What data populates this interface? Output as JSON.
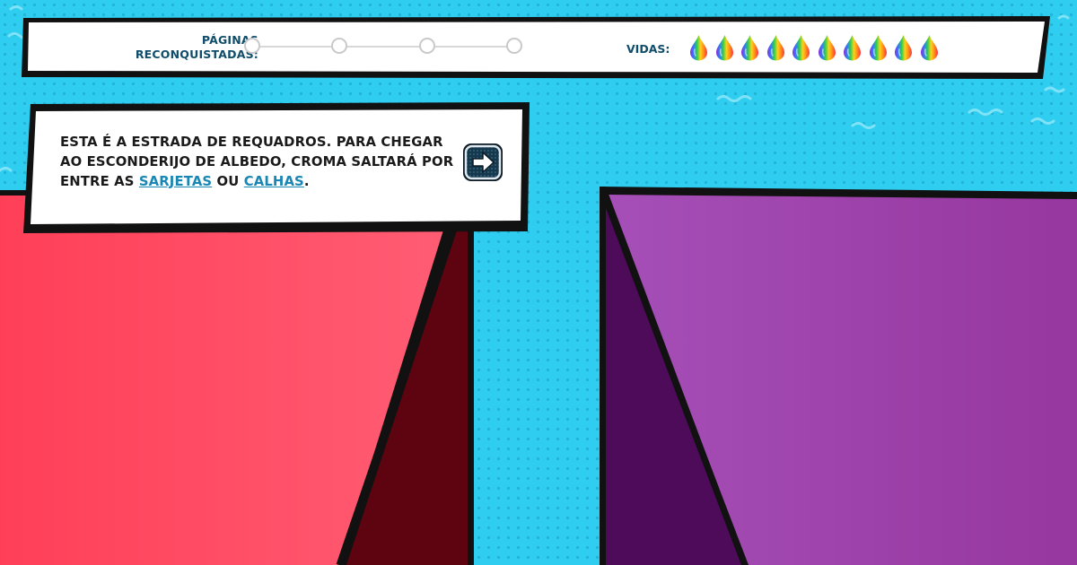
{
  "status_bar": {
    "pages_label_line1": "PÁGINAS",
    "pages_label_line2": "RECONQUISTADAS:",
    "pages_total": 4,
    "pages_reclaimed": 0,
    "lives_label": "VIDAS:",
    "lives_count": 10,
    "life_icon": "rainbow-drop-icon"
  },
  "dialog": {
    "text_line1": "ESTA É A ESTRADA DE REQUADROS. PARA CHEGAR",
    "text_line2": "AO ESCONDERIJO DE ALBEDO, CROMA SALTARÁ POR",
    "text_line3_prefix": "ENTRE AS ",
    "link1": "SARJETAS",
    "text_between": " OU ",
    "link2": "CALHAS",
    "text_suffix": ".",
    "next_icon": "arrow-right-icon"
  },
  "colors": {
    "sky": "#2fcdf0",
    "panel_red": "#ff4a63",
    "panel_red_shadow": "#5e0410",
    "panel_purple": "#a24bb6",
    "panel_purple_shadow": "#4e0b5a",
    "text_dark": "#0f4d6b",
    "link": "#1a86b4"
  }
}
